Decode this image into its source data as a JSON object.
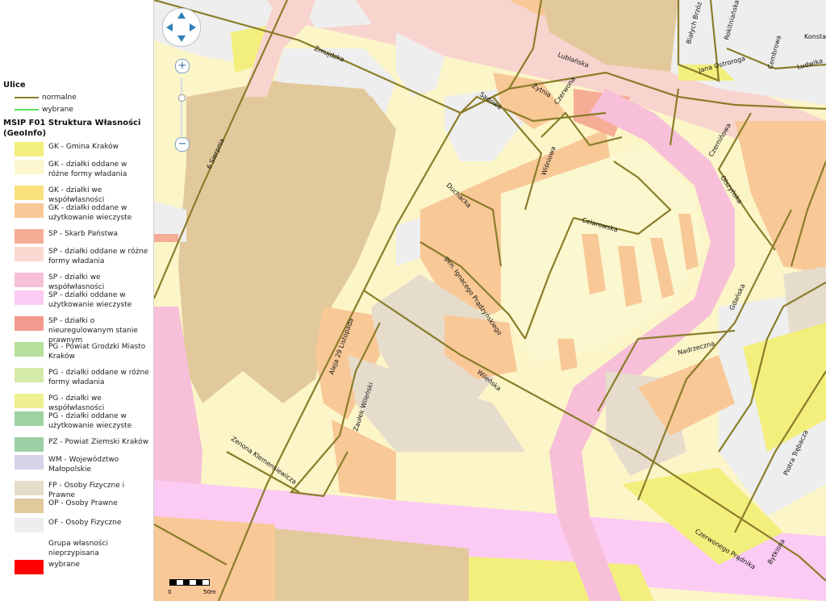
{
  "legend": {
    "streets": {
      "title": "Ulice",
      "items": [
        {
          "label": "normalne",
          "color": "#8a7d2a"
        },
        {
          "label": "wybrane",
          "color": "#5ee05e"
        }
      ]
    },
    "ownership": {
      "title": "MSIP F01 Struktura Własności (GeoInfo)",
      "items": [
        {
          "label": "GK - Gmina Kraków",
          "color": "#f3ef7d"
        },
        {
          "label": "GK - działki oddane w różne formy władania",
          "color": "#fbf7cf"
        },
        {
          "label": "GK - działki we współwłasności",
          "color": "#f9e27d"
        },
        {
          "label": "GK - działki oddane w użytkowanie wieczyste",
          "color": "#f9c897"
        },
        {
          "label": "SP - Skarb Państwa",
          "color": "#f6ad96"
        },
        {
          "label": "SP - działki oddane w różne formy władania",
          "color": "#fbd9d3"
        },
        {
          "label": "SP - działki we współwłasności",
          "color": "#f7bfd8"
        },
        {
          "label": "SP - działki oddane w użytkowanie wieczyste",
          "color": "#fbcbf3"
        },
        {
          "label": "SP - działki o nieuregulowanym stanie prawnym",
          "color": "#f39a8e"
        },
        {
          "label": "PG - Powiat Grodzki Miasto Kraków",
          "color": "#b5df9b"
        },
        {
          "label": "PG - działki oddane w różne formy władania",
          "color": "#d5eaa8"
        },
        {
          "label": "PG - działki we współwłasności",
          "color": "#eef08f"
        },
        {
          "label": "PG - działki oddane w użytkowanie wieczyste",
          "color": "#9dd2a3"
        },
        {
          "label": "PZ - Powiat Ziemski Kraków",
          "color": "#9ccfa4"
        },
        {
          "label": "WM - Województwo Małopolskie",
          "color": "#d7d2e8"
        },
        {
          "label": "FP - Osoby Fizyczne i Prawne",
          "color": "#e6dccc"
        },
        {
          "label": "OP - Osoby Prawne",
          "color": "#e2c99c"
        },
        {
          "label": "OF - Osoby Fizyczne",
          "color": "#eeeeee"
        },
        {
          "label": "Grupa własności nieprzypisana",
          "color": "#ffffff"
        },
        {
          "label": "wybrane",
          "color": "#ff0000"
        }
      ]
    }
  },
  "map": {
    "street_color": "#8a7d2a",
    "streets": [
      "Żmujdzka",
      "Lublańska",
      "6 Sierpnia",
      "Sadowa",
      "Żytnia",
      "Czerwona",
      "Duchacka",
      "Wiśniowa",
      "Celarowska",
      "gen. Ignacego Prądzyńskiego",
      "Aleja 29 Listopada",
      "Wileńska",
      "Zaułek Wileński",
      "Zenona Klemensiewicza",
      "Białych Brzóz",
      "Rokitniańska",
      "Cembrowa",
      "Jana Ostroroga",
      "Konstan",
      "Ludwika",
      "Czerniňowa",
      "Olszyńska",
      "Gdańska",
      "Nadrzeczna",
      "Piotra Trębacza",
      "Czerwonego Prądnika",
      "Bytkisna"
    ],
    "scale": {
      "start": "0",
      "end": "50m"
    }
  },
  "nav": {
    "zoom_in": "+",
    "zoom_out": "−"
  }
}
